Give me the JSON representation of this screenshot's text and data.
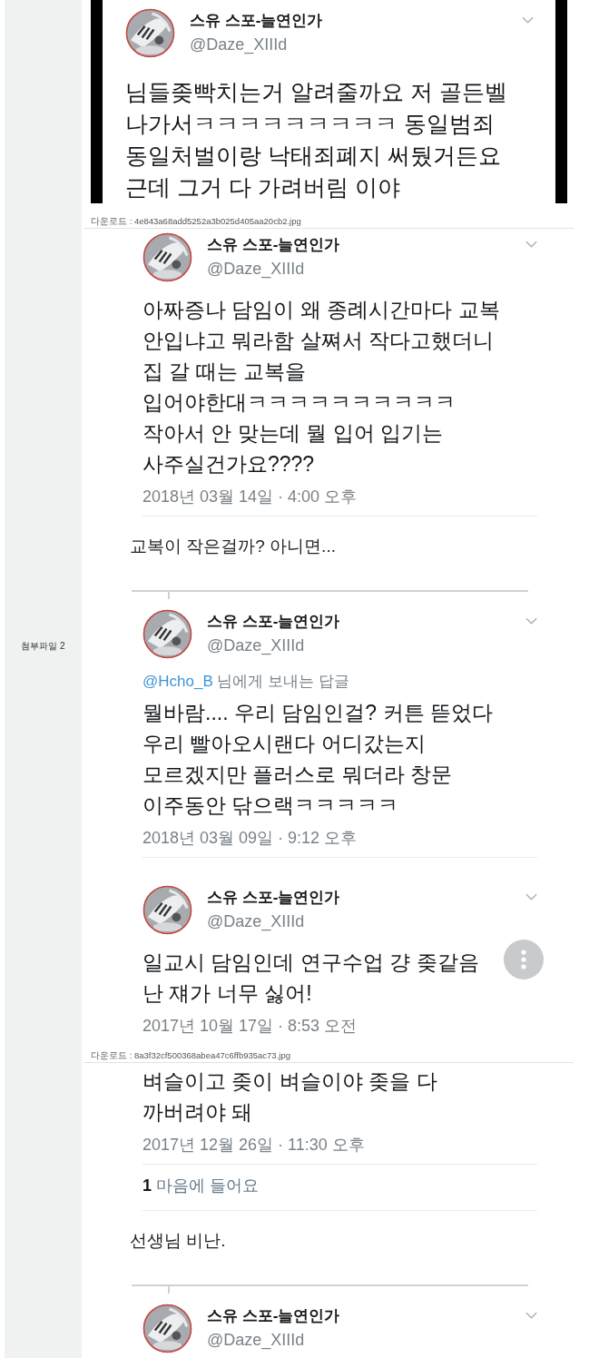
{
  "attachments": [
    {
      "kind": "framed",
      "caption": "다운로드 : 4e843a68add5252a3b025d405aa20cb2.jpg",
      "overlay_button": false,
      "blocks": [
        {
          "kind": "tweet",
          "name": "스유 스포-늘연인가",
          "handle": "@Daze_XIIId",
          "body": "님들좆빡치는거 알려줄까요 저 골든벨\n나가서ㅋㅋㅋㅋㅋㅋㅋㅋㅋ 동일범죄\n동일처벌이랑 낙태죄폐지 써뒀거든요\n근데 그거 다 가려버림 이야"
        }
      ]
    },
    {
      "kind": "plain",
      "label": "첨부파일 2",
      "caption": "다운로드 : 8a3f32cf500368abea47c6ffb935ac73.jpg",
      "overlay_button": true,
      "blocks": [
        {
          "kind": "tweet",
          "name": "스유 스포-늘연인가",
          "handle": "@Daze_XIIId",
          "body": "아짜증나 담임이 왜 종례시간마다 교복\n안입냐고 뭐라함 살쪄서 작다고했더니\n집 갈 때는 교복을\n입어야한대ㅋㅋㅋㅋㅋㅋㅋㅋㅋㅋ\n작아서 안 맞는데 뭘 입어 입기는\n사주실건가요????",
          "date": "2018년 03월 14일 · 4:00 오후"
        },
        {
          "kind": "rule"
        },
        {
          "kind": "comment",
          "text": "교복이 작은걸까? 아니면..."
        },
        {
          "kind": "separator"
        },
        {
          "kind": "tweet",
          "name": "스유 스포-늘연인가",
          "handle": "@Daze_XIIId",
          "reply_to": "@Hcho_B",
          "reply_text": "님에게 보내는 답글",
          "body": "뭘바람.... 우리 담임인걸? 커튼 뜯었다\n우리 빨아오시랜다 어디갔는지\n모르겠지만 플러스로 뭐더라 창문\n이주동안 닦으랙ㅋㅋㅋㅋㅋ",
          "date": "2018년 03월 09일 · 9:12 오후"
        },
        {
          "kind": "rule"
        },
        {
          "kind": "tweet",
          "name": "스유 스포-늘연인가",
          "handle": "@Daze_XIIId",
          "body": "일교시 담임인데 연구수업 걍 좆같음\n난 쟤가 너무 싫어!",
          "date": "2017년 10월 17일 · 8:53 오전"
        }
      ]
    },
    {
      "kind": "plain",
      "overlay_button": false,
      "blocks": [
        {
          "kind": "tweet",
          "body": "벼슬이고 좆이 벼슬이야 좆을 다\n까버려야 돼",
          "date": "2017년 12월 26일 · 11:30 오후"
        },
        {
          "kind": "rule"
        },
        {
          "kind": "likes",
          "text": "**1** 마음에 들어요"
        },
        {
          "kind": "rule"
        },
        {
          "kind": "comment",
          "text": "선생님 비난."
        },
        {
          "kind": "separator"
        },
        {
          "kind": "tweet",
          "name": "스유 스포-늘연인가",
          "handle": "@Daze_XIIId"
        }
      ]
    }
  ]
}
